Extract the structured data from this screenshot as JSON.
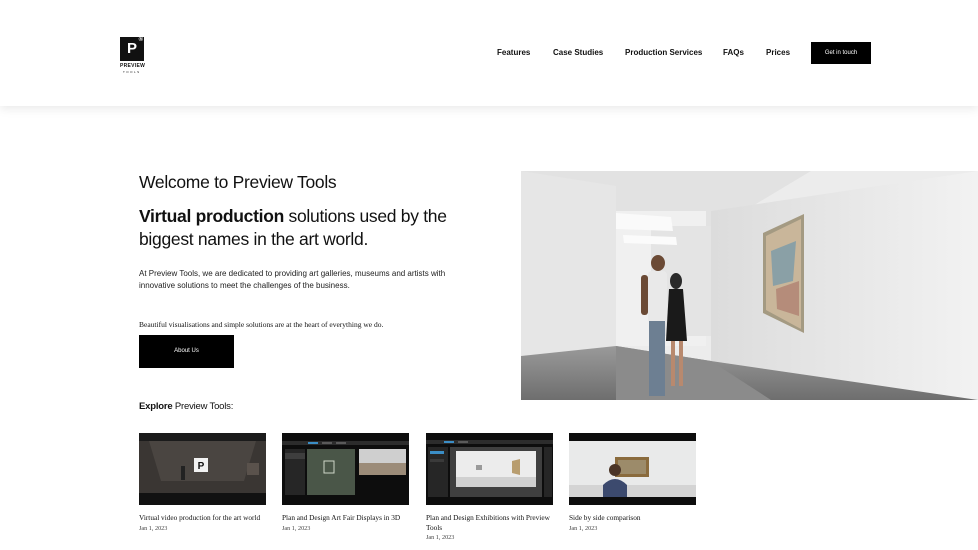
{
  "brand": {
    "name": "PREVIEW",
    "sub": "TOOLS",
    "mark": "P",
    "reg": "®"
  },
  "nav": {
    "items": [
      {
        "label": "Features"
      },
      {
        "label": "Case Studies"
      },
      {
        "label": "Production Services"
      },
      {
        "label": "FAQs"
      },
      {
        "label": "Prices"
      }
    ],
    "cta_label": "Get in touch"
  },
  "hero": {
    "welcome": "Welcome to Preview Tools",
    "headline_bold": "Virtual production",
    "headline_rest": " solutions used by the biggest names in the art world.",
    "intro": "At Preview Tools, we are dedicated to providing  art galleries, museums and artists with innovative solutions to meet the challenges of the business.",
    "tagline": "Beautiful visualisations and simple solutions are at the heart of everything we do.",
    "about_label": "About Us"
  },
  "explore": {
    "bold": "Explore",
    "rest": " Preview Tools:"
  },
  "cards": [
    {
      "title": "Virtual video production for the art world",
      "date": "Jan 1, 2023"
    },
    {
      "title": "Plan and Design Art Fair Displays in 3D",
      "date": "Jan 1, 2023"
    },
    {
      "title": "Plan and Design Exhibitions with Preview Tools",
      "date": "Jan 1, 2023"
    },
    {
      "title": "Side by side comparison",
      "date": "Jan 1, 2023"
    }
  ],
  "colors": {
    "accent": "#000000",
    "background": "#ffffff",
    "text": "#111111"
  }
}
